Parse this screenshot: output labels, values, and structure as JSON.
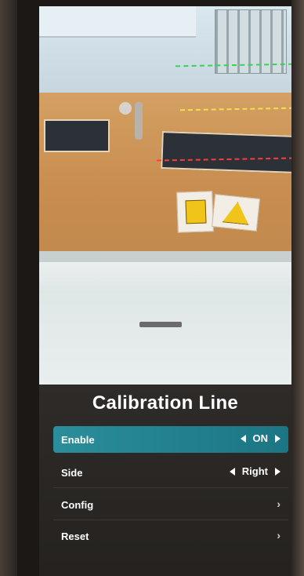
{
  "menu": {
    "title": "Calibration Line",
    "items": [
      {
        "label": "Enable",
        "value": "ON"
      },
      {
        "label": "Side",
        "value": "Right"
      },
      {
        "label": "Config"
      },
      {
        "label": "Reset"
      }
    ]
  },
  "colors": {
    "highlight": "#1f7d8a",
    "calibration_green": "#39d353",
    "calibration_yellow": "#f2e14a",
    "calibration_red": "#ff3b3b"
  },
  "icons": {
    "prev": "arrow-left-icon",
    "next": "arrow-right-icon",
    "submenu": "chevron-right-icon"
  }
}
